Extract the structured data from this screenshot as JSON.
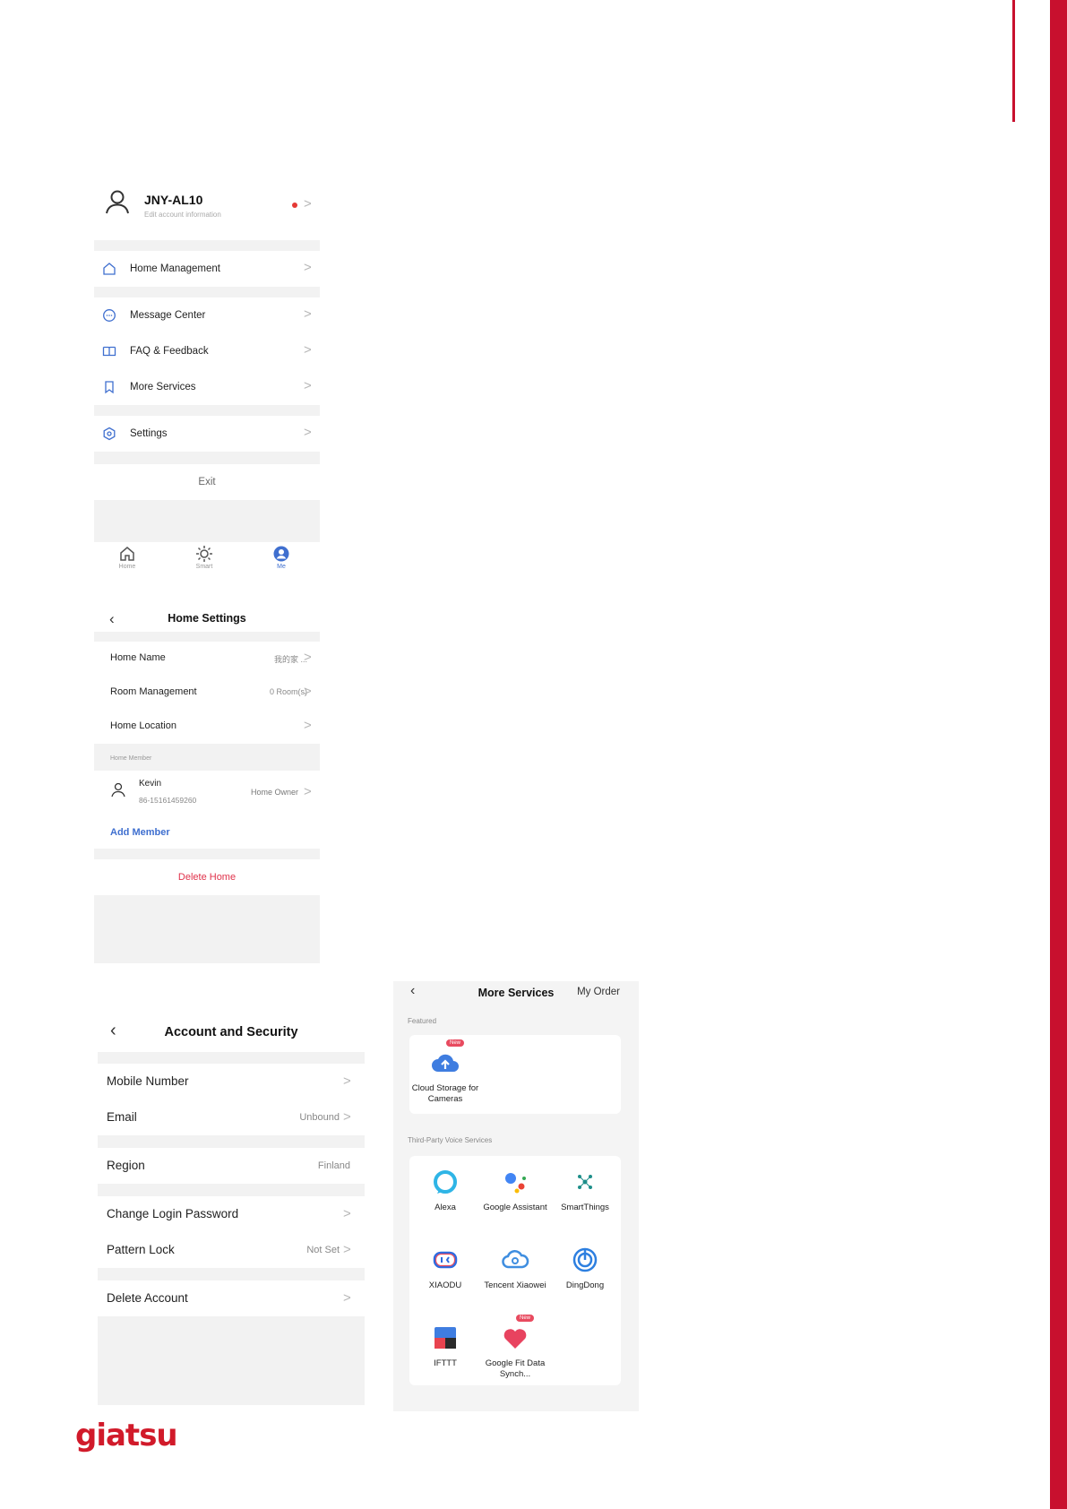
{
  "colors": {
    "brand_red": "#c8102e",
    "accent_blue": "#3f6fcf",
    "delete_red": "#e0324b"
  },
  "me_screen": {
    "profile": {
      "name": "JNY-AL10",
      "subtitle": "Edit account information"
    },
    "menu": [
      {
        "label": "Home Management",
        "icon": "house-icon"
      },
      {
        "label": "Message Center",
        "icon": "chat-bubble-icon"
      },
      {
        "label": "FAQ & Feedback",
        "icon": "book-icon"
      },
      {
        "label": "More Services",
        "icon": "bookmark-icon"
      },
      {
        "label": "Settings",
        "icon": "hexagon-gear-icon"
      }
    ],
    "exit_label": "Exit",
    "tabs": [
      {
        "label": "Home",
        "icon": "home-icon",
        "active": false
      },
      {
        "label": "Smart",
        "icon": "sun-icon",
        "active": false
      },
      {
        "label": "Me",
        "icon": "person-icon",
        "active": true
      }
    ]
  },
  "home_settings": {
    "title": "Home Settings",
    "rows": [
      {
        "label": "Home Name",
        "value": "我的家 ..."
      },
      {
        "label": "Room Management",
        "value": "0 Room(s)"
      },
      {
        "label": "Home Location",
        "value": ""
      }
    ],
    "section_label": "Home Member",
    "member": {
      "name": "Kevin",
      "phone": "86-15161459260",
      "role": "Home Owner"
    },
    "add_member": "Add Member",
    "delete_home": "Delete Home"
  },
  "account_security": {
    "title": "Account and Security",
    "rows": [
      {
        "label": "Mobile Number",
        "value": ""
      },
      {
        "label": "Email",
        "value": "Unbound"
      },
      {
        "label": "Region",
        "value": "Finland"
      },
      {
        "label": "Change Login Password",
        "value": ""
      },
      {
        "label": "Pattern Lock",
        "value": "Not Set"
      },
      {
        "label": "Delete Account",
        "value": ""
      }
    ]
  },
  "more_services": {
    "title": "More Services",
    "order_label": "My Order",
    "featured_label": "Featured",
    "featured": [
      {
        "name": "Cloud Storage for Cameras",
        "badge": "New",
        "icon": "cloud-upload-icon"
      }
    ],
    "voice_label": "Third-Party Voice Services",
    "voice_services": [
      {
        "name": "Alexa",
        "icon": "alexa-ring-icon"
      },
      {
        "name": "Google Assistant",
        "icon": "google-assistant-icon"
      },
      {
        "name": "SmartThings",
        "icon": "smartthings-icon"
      },
      {
        "name": "XIAODU",
        "icon": "xiaodu-icon"
      },
      {
        "name": "Tencent Xiaowei",
        "icon": "cloud-outline-icon"
      },
      {
        "name": "DingDong",
        "icon": "dingdong-icon"
      },
      {
        "name": "IFTTT",
        "icon": "ifttt-icon"
      },
      {
        "name": "Google Fit Data Synch...",
        "badge": "New",
        "icon": "heart-icon"
      }
    ]
  },
  "logo_text": "giatsu"
}
